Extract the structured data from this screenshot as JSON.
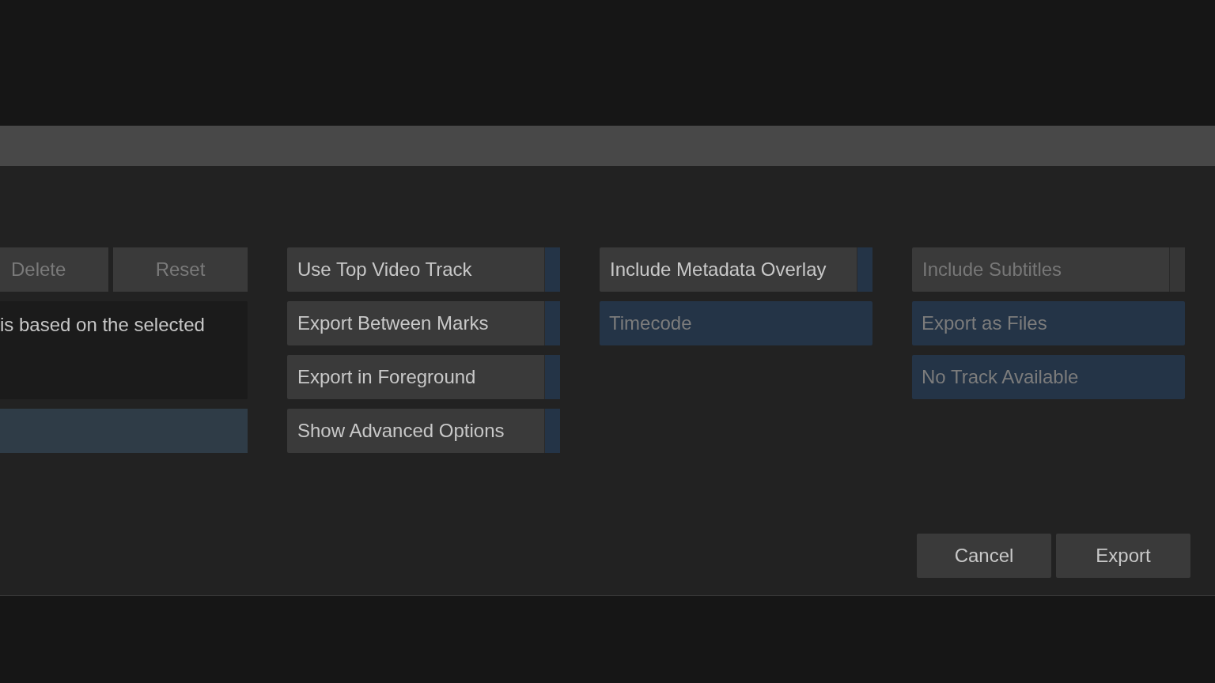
{
  "left_panel": {
    "buttons": [
      {
        "label": "Delete",
        "disabled": true
      },
      {
        "label": "Reset",
        "disabled": true
      }
    ],
    "description": "is based on the selected"
  },
  "columns": [
    {
      "items": [
        {
          "kind": "toggle",
          "label": "Use Top Video Track",
          "disabled": false
        },
        {
          "kind": "toggle",
          "label": "Export Between Marks",
          "disabled": false
        },
        {
          "kind": "toggle",
          "label": "Export in Foreground",
          "disabled": false
        },
        {
          "kind": "toggle",
          "label": "Show Advanced Options",
          "disabled": false
        }
      ]
    },
    {
      "items": [
        {
          "kind": "toggle",
          "label": "Include Metadata Overlay",
          "disabled": false
        },
        {
          "kind": "selector",
          "label": "Timecode",
          "disabled": true
        }
      ]
    },
    {
      "items": [
        {
          "kind": "toggle",
          "label": "Include Subtitles",
          "disabled": true
        },
        {
          "kind": "selector",
          "label": "Export as Files",
          "disabled": true
        },
        {
          "kind": "selector",
          "label": "No Track Available",
          "disabled": true
        }
      ]
    }
  ],
  "footer_buttons": [
    "Cancel",
    "Export"
  ]
}
